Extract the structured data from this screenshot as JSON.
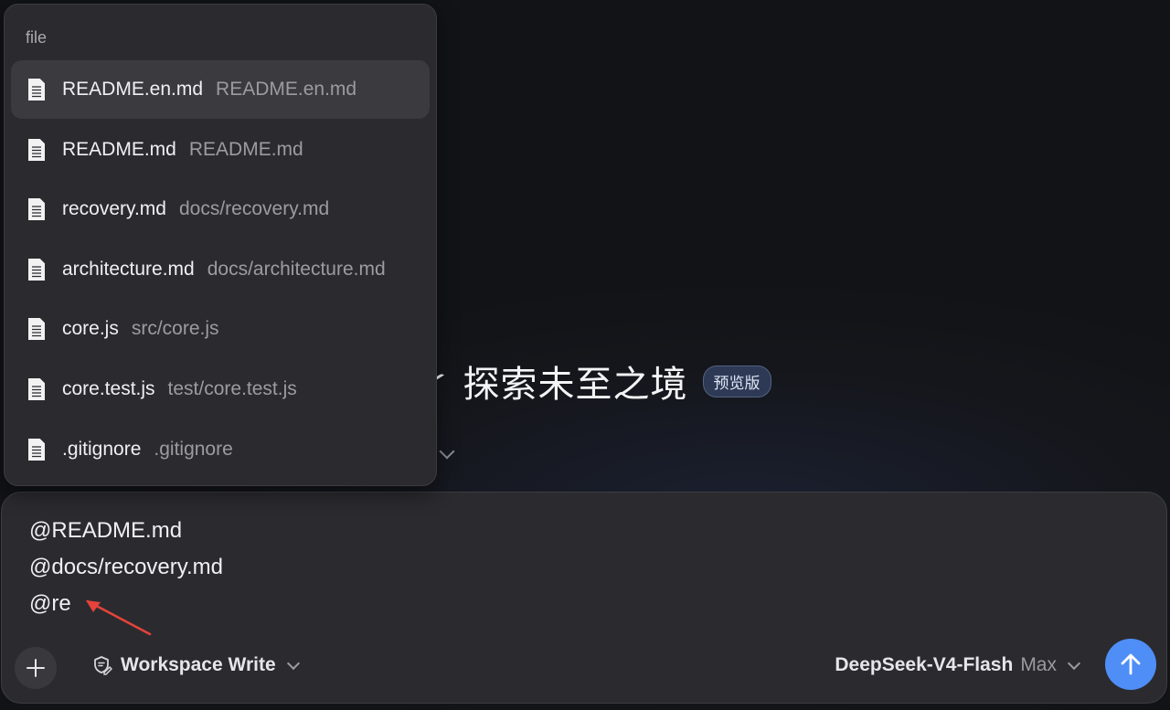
{
  "hero": {
    "title": "探索未至之境",
    "badge": "预览版"
  },
  "popup": {
    "header": "file",
    "items": [
      {
        "name": "README.en.md",
        "path": "README.en.md",
        "active": true
      },
      {
        "name": "README.md",
        "path": "README.md",
        "active": false
      },
      {
        "name": "recovery.md",
        "path": "docs/recovery.md",
        "active": false
      },
      {
        "name": "architecture.md",
        "path": "docs/architecture.md",
        "active": false
      },
      {
        "name": "core.js",
        "path": "src/core.js",
        "active": false
      },
      {
        "name": "core.test.js",
        "path": "test/core.test.js",
        "active": false
      },
      {
        "name": ".gitignore",
        "path": ".gitignore",
        "active": false
      }
    ]
  },
  "composer": {
    "lines": [
      "@README.md",
      "@docs/recovery.md",
      "@re"
    ],
    "mode_label": "Workspace Write",
    "model_name": "DeepSeek-V4-Flash",
    "model_tier": "Max"
  },
  "colors": {
    "accent": "#4f8ef7",
    "annotation_arrow": "#e5433b"
  }
}
